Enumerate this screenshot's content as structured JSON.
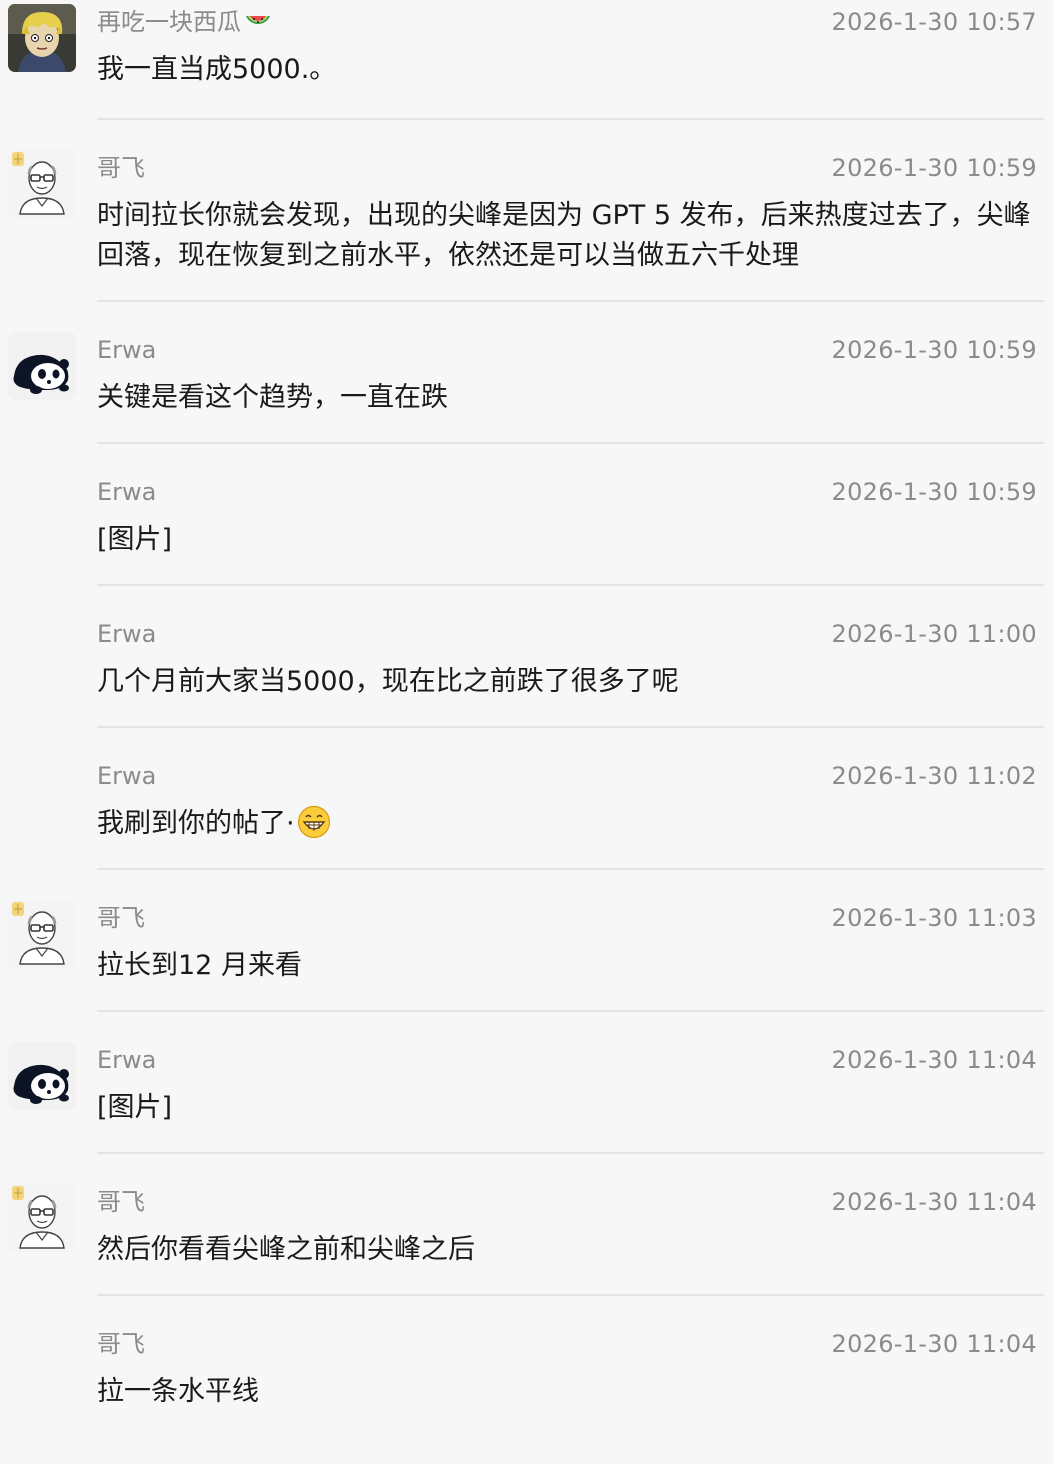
{
  "comments": [
    {
      "user": "再吃一块西瓜",
      "user_emoji": "watermelon-icon",
      "time": "2026-1-30 10:57",
      "text": "我一直当成5000.。",
      "avatar": "blonde-character-avatar"
    },
    {
      "user": "哥飞",
      "time": "2026-1-30 10:59",
      "text": "时间拉长你就会发现，出现的尖峰是因为 GPT 5 发布，后来热度过去了，尖峰回落，现在恢复到之前水平，依然还是可以当做五六千处理",
      "avatar": "bald-man-glasses-avatar"
    },
    {
      "user": "Erwa",
      "time": "2026-1-30 10:59",
      "text": "关键是看这个趋势，一直在跌",
      "avatar": "panda-avatar"
    },
    {
      "user": "Erwa",
      "time": "2026-1-30 10:59",
      "text": "[图片]"
    },
    {
      "user": "Erwa",
      "time": "2026-1-30 11:00",
      "text": "几个月前大家当5000，现在比之前跌了很多了呢"
    },
    {
      "user": "Erwa",
      "time": "2026-1-30 11:02",
      "text": "我刷到你的帖了·",
      "text_emoji": "grinning-face-icon"
    },
    {
      "user": "哥飞",
      "time": "2026-1-30 11:03",
      "text": "拉长到12 月来看",
      "avatar": "bald-man-glasses-avatar"
    },
    {
      "user": "Erwa",
      "time": "2026-1-30 11:04",
      "text": "[图片]",
      "avatar": "panda-avatar"
    },
    {
      "user": "哥飞",
      "time": "2026-1-30 11:04",
      "text": "然后你看看尖峰之前和尖峰之后",
      "avatar": "bald-man-glasses-avatar"
    },
    {
      "user": "哥飞",
      "time": "2026-1-30 11:04",
      "text": "拉一条水平线"
    }
  ]
}
